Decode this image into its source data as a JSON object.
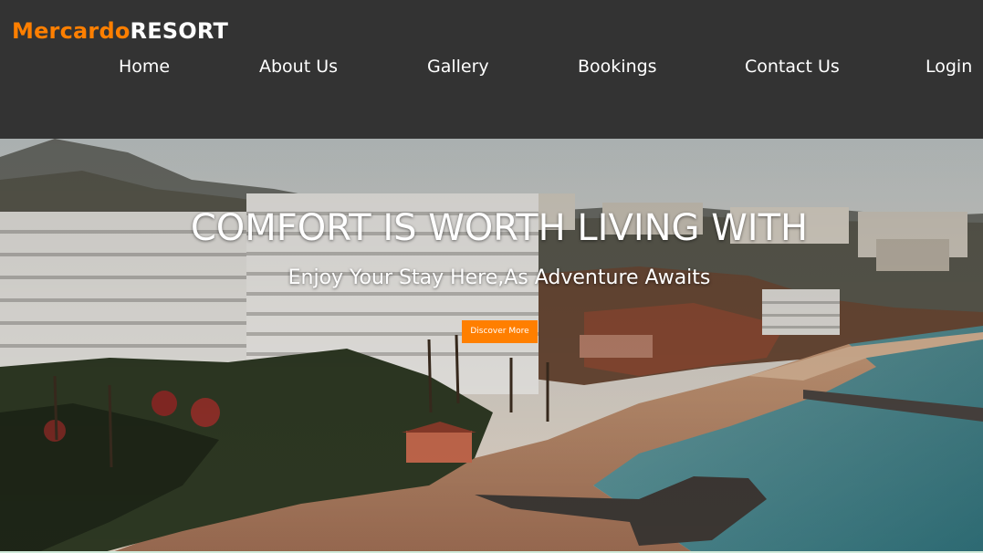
{
  "brand": {
    "name_part1": "Mercardo",
    "name_part2": "RESORT",
    "accent_color": "#ff7f00"
  },
  "nav": {
    "items": [
      {
        "label": "Home"
      },
      {
        "label": "About Us"
      },
      {
        "label": "Gallery"
      },
      {
        "label": "Bookings"
      },
      {
        "label": "Contact Us"
      },
      {
        "label": "Login"
      }
    ]
  },
  "hero": {
    "headline": "COMFORT IS WORTH LIVING WITH",
    "subheadline": "Enjoy Your Stay Here,As Adventure Awaits",
    "cta_label": "Discover More",
    "background_image": "aerial-coastal-resort-photo"
  },
  "colors": {
    "header_bg": "#333333",
    "text": "#ffffff",
    "cta_bg": "#ff7f00"
  }
}
